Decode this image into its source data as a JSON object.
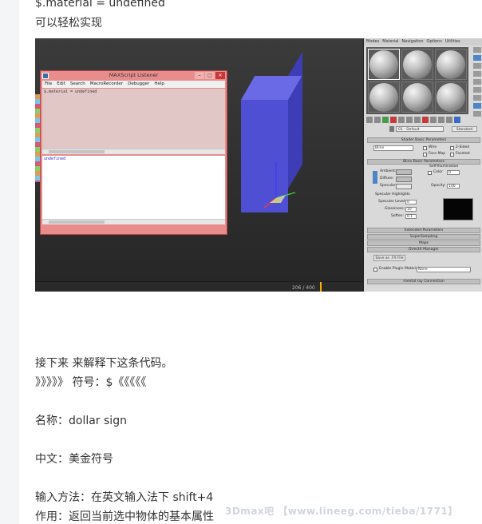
{
  "article": {
    "line_top": "$.material = undefined",
    "line_easy": "可以轻松实现",
    "line_explain": "接下来 来解释下这条代码。",
    "line_symbol": "》》》》》 符号：$《《《《《",
    "line_name": "名称：dollar sign",
    "line_chinese": "中文：美金符号",
    "line_input": "输入方法：在英文输入法下 shift+4",
    "line_effect": "作用：返回当前选中物体的基本属性"
  },
  "listener": {
    "title": "MAXScript Listener",
    "menu": [
      "File",
      "Edit",
      "Search",
      "MacroRecorder",
      "Debugger",
      "Help"
    ],
    "input_code": "$.material = undefined",
    "output_code": "undefined"
  },
  "viewport": {
    "frame_counter": "206 / 400"
  },
  "material_editor": {
    "menu": [
      "Modes",
      "Material",
      "Navigation",
      "Options",
      "Utilities"
    ],
    "material_name": "01 - Default",
    "type_button": "Standard",
    "rollouts": {
      "shader_basic": "Shader Basic Parameters",
      "blinn_basic": "Blinn Basic Parameters",
      "extended": "Extended Parameters",
      "supersampling": "SuperSampling",
      "maps": "Maps",
      "directx": "DirectX Manager",
      "mentalray": "mental ray Connection"
    },
    "shader_type": "Blinn",
    "options": [
      "Wire",
      "2-Sided",
      "Face Map",
      "Faceted"
    ],
    "self_illumination": "Self-Illumination",
    "color_label": "Color",
    "color_value": "0",
    "ambient": "Ambient:",
    "diffuse": "Diffuse:",
    "specular": "Specular:",
    "opacity_label": "Opacity:",
    "opacity_value": "100",
    "specular_highlights": "Specular Highlights",
    "specular_level": "Specular Level:",
    "specular_level_value": "0",
    "glossiness": "Glossiness:",
    "glossiness_value": "10",
    "soften": "Soften:",
    "soften_value": "0.1",
    "save_fx": "Save as .FX File",
    "enable_plugin": "Enable Plugin Material",
    "plugin_value": "None"
  },
  "watermark": "3Dmax吧 【www.lineeg.com/tieba/1771】"
}
